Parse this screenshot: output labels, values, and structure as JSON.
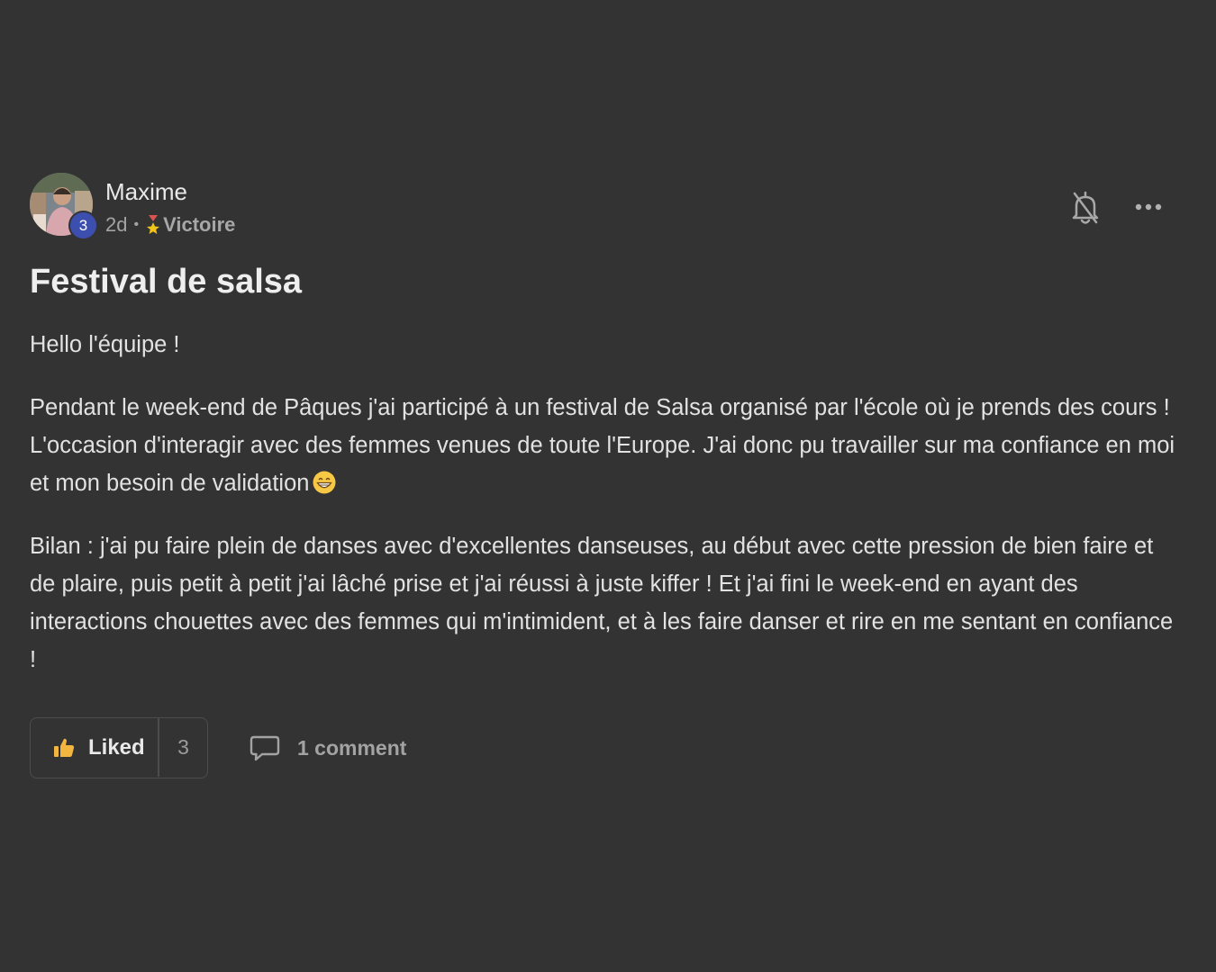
{
  "post": {
    "author": {
      "name": "Maxime",
      "level": "3",
      "avatar_icon": "user-photo"
    },
    "meta": {
      "time": "2d",
      "separator": "•",
      "category": "Victoire",
      "category_icon": "medal-icon"
    },
    "title": "Festival de salsa",
    "paragraphs": [
      "Hello l'équipe !",
      "Pendant le week-end de Pâques j'ai participé à un festival de Salsa organisé par l'école où je prends des cours ! L'occasion d'interagir avec des femmes venues de toute l'Europe. J'ai donc pu travailler sur ma confiance en moi et mon besoin de validation",
      "Bilan : j'ai pu faire plein de danses avec d'excellentes danseuses, au début avec cette pression de bien faire et de plaire, puis petit à petit j'ai lâché prise et j'ai réussi à juste kiffer ! Et j'ai fini le week-end en ayant des interactions chouettes avec des femmes qui m'intimident, et à les faire danser et rire en me sentant en confiance !"
    ],
    "paragraph_emoji": "grinning-face-emoji"
  },
  "actions": {
    "like_label": "Liked",
    "like_count": "3",
    "comment_label": "1 comment"
  },
  "colors": {
    "background": "#333333",
    "level_badge": "#3d4fae",
    "like_thumb": "#f2b640"
  }
}
